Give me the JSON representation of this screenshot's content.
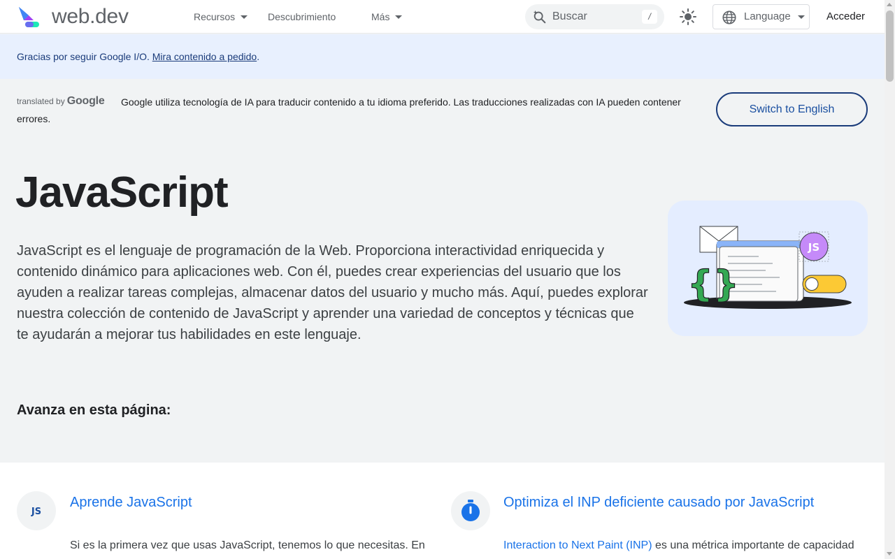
{
  "header": {
    "logo_text": "web.dev",
    "nav": [
      {
        "label": "Recursos",
        "has_menu": true
      },
      {
        "label": "Descubrimiento",
        "has_menu": false
      },
      {
        "label": "Más",
        "has_menu": true
      }
    ],
    "search": {
      "placeholder": "Buscar",
      "shortcut": "/"
    },
    "language_label": "Language",
    "signin_label": "Acceder"
  },
  "banner": {
    "text": "Gracias por seguir Google I/O. ",
    "link_text": "Mira contenido a pedido",
    "suffix": "."
  },
  "translation": {
    "translated_by": "translated by",
    "google": "Google",
    "notice": "Google utiliza tecnología de IA para traducir contenido a tu idioma preferido. Las traducciones realizadas con IA pueden contener errores.",
    "switch_label": "Switch to English"
  },
  "hero": {
    "title": "JavaScript",
    "description": "JavaScript es el lenguaje de programación de la Web. Proporciona interactividad enriquecida y contenido dinámico para aplicaciones web. Con él, puedes crear experiencias del usuario que los ayuden a realizar tareas complejas, almacenar datos del usuario y mucho más. Aquí, puedes explorar nuestra colección de contenido de JavaScript y aprender una variedad de conceptos y técnicas que te ayudarán a mejorar tus habilidades en este lenguaje.",
    "art_badge": "JS"
  },
  "toc": {
    "title": "Avanza en esta página:"
  },
  "cards": [
    {
      "icon": "js-badge-icon",
      "icon_text": "JS",
      "title": "Aprende JavaScript",
      "text": "Si es la primera vez que usas JavaScript, tenemos lo que necesitas. En"
    },
    {
      "icon": "stopwatch-icon",
      "title": "Optimiza el INP deficiente causado por JavaScript",
      "link_text": "Interaction to Next Paint (INP)",
      "text": " es una métrica importante de capacidad"
    }
  ],
  "colors": {
    "accent": "#1a73e8",
    "banner_bg": "#e8f0fe",
    "page_bg": "#f1f3f4",
    "art_bg": "#e4edff",
    "js_purple": "#c58af9",
    "toggle_yellow": "#fcc934",
    "brace_green": "#34a853"
  }
}
